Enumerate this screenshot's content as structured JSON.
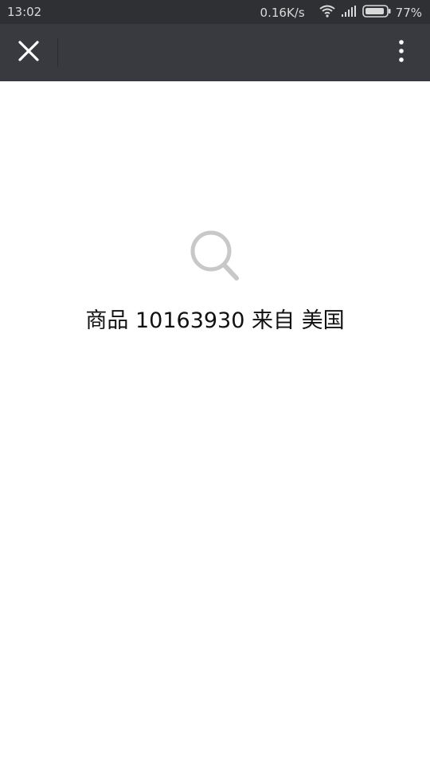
{
  "status_bar": {
    "time": "13:02",
    "network_speed": "0.16K/s",
    "battery": "77%",
    "icons": [
      "wifi-icon",
      "signal-icon",
      "battery-icon"
    ]
  },
  "title_bar": {
    "icons": [
      "close-icon",
      "more-vertical-icon"
    ]
  },
  "main": {
    "icon": "search-icon",
    "message": "商品 10163930 来自 美国"
  }
}
